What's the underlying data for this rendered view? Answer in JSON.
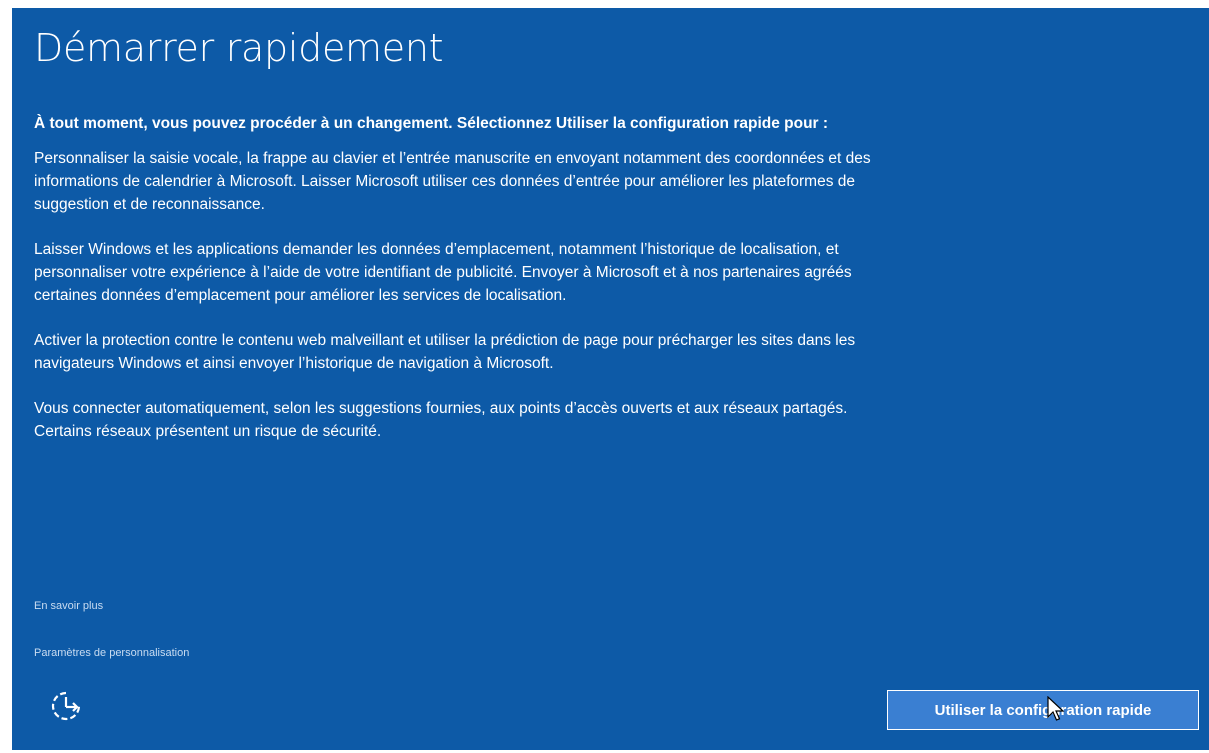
{
  "page": {
    "title": "Démarrer rapidement",
    "intro": "À tout moment, vous pouvez procéder à un changement. Sélectionnez Utiliser la configuration rapide pour :",
    "paragraphs": [
      "Personnaliser la saisie vocale, la frappe au clavier et l’entrée manuscrite en envoyant notamment des coordonnées et des informations de calendrier à Microsoft. Laisser Microsoft utiliser ces données d’entrée pour améliorer les plateformes de suggestion et de reconnaissance.",
      "Laisser Windows et les applications demander les données d’emplacement, notamment l’historique de localisation, et personnaliser votre expérience à l’aide de votre identifiant de publicité. Envoyer à Microsoft et à nos partenaires agréés certaines données d’emplacement pour améliorer les services de localisation.",
      "Activer la protection contre le contenu web malveillant et utiliser la prédiction de page pour précharger les sites dans les navigateurs Windows et ainsi envoyer l’historique de navigation à Microsoft.",
      "Vous connecter automatiquement, selon les suggestions fournies, aux points d’accès ouverts et aux réseaux partagés. Certains réseaux présentent un risque de sécurité."
    ]
  },
  "links": {
    "learn_more": "En savoir plus",
    "customize_settings": "Paramètres de personnalisation"
  },
  "footer": {
    "ease_of_access_icon": "ease-of-access-icon",
    "primary_button_label": "Utiliser la configuration rapide"
  },
  "colors": {
    "background": "#0d5aa7",
    "button": "#3a7fd2",
    "text": "#ffffff",
    "link": "#c9dcf1"
  }
}
